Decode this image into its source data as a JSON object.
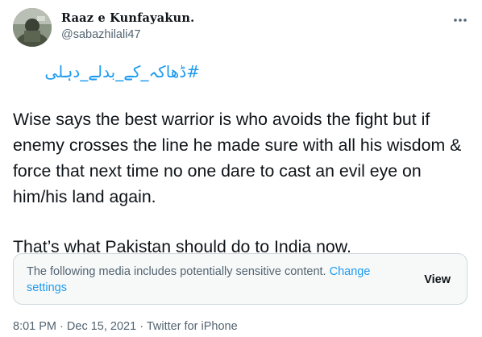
{
  "tweet": {
    "author": {
      "display_name": "Raaz e Kunfayakun.",
      "handle": "@sabazhilali47",
      "avatar_icon": "profile-photo"
    },
    "more_icon": "more-options-icon",
    "hashtag": "#ڈھاکہ_کے_بدلے_دہلی",
    "body": {
      "paragraph_1": "Wise says the best warrior is who avoids the fight but if enemy crosses the line he made sure with all his wisdom & force that next time no one dare to cast an evil eye on him/his land again.",
      "paragraph_2": "That’s what Pakistan should do to India now."
    },
    "sensitive_notice": {
      "text": "The following media includes potentially sensitive content.",
      "link_label": "Change settings",
      "view_label": "View"
    },
    "meta": {
      "time": "8:01 PM",
      "separator": "·",
      "date": "Dec 15, 2021",
      "source": "Twitter for iPhone"
    }
  },
  "colors": {
    "accent": "#1d9bf0",
    "text_primary": "#0f1419",
    "text_secondary": "#536471",
    "notice_bg": "#f7f9f9",
    "notice_border": "#cfd9de"
  }
}
